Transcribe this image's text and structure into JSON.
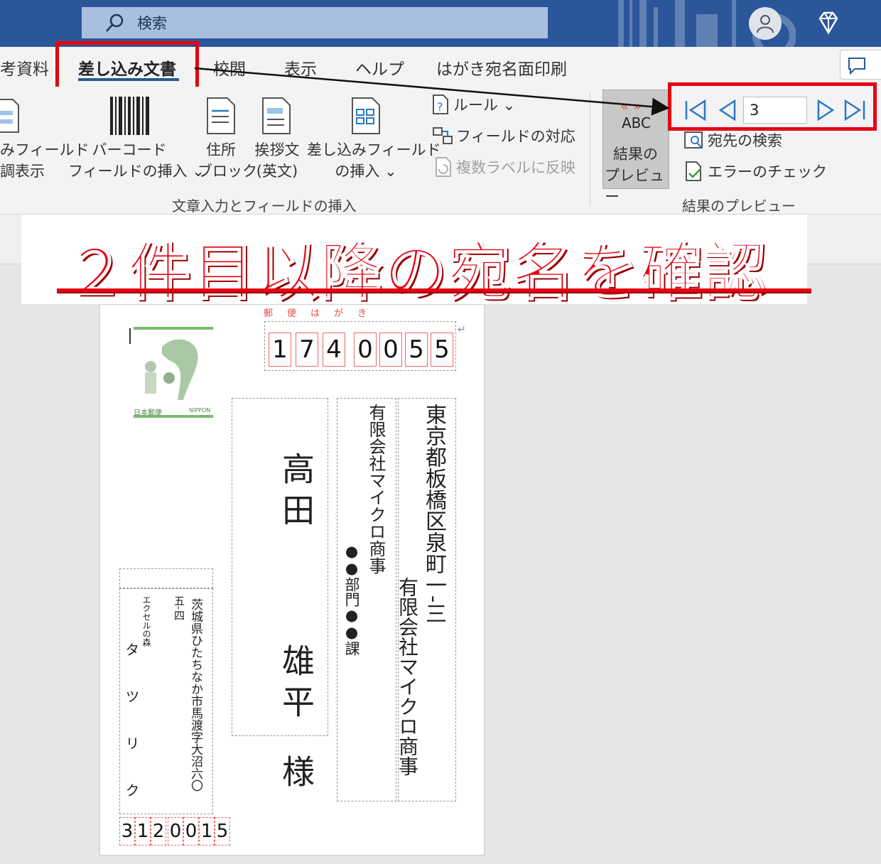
{
  "search": {
    "placeholder_text": "検索"
  },
  "tabs": [
    {
      "label": "考資料"
    },
    {
      "label": "差し込み文書"
    },
    {
      "label": "校閲"
    },
    {
      "label": "表示"
    },
    {
      "label": "ヘルプ"
    },
    {
      "label": "はがき宛名面印刷"
    }
  ],
  "ribbon": {
    "fields_highlight": {
      "line1": "みフィールド",
      "line2": "調表示"
    },
    "barcode": {
      "line1": "バーコード",
      "line2": "フィールドの挿入 ⌄"
    },
    "address_block": {
      "line1": "住所",
      "line2": "ブロック"
    },
    "greeting": {
      "line1": "挨拶文",
      "line2": "(英文)"
    },
    "insert_merge_field": {
      "line1": "差し込みフィールド",
      "line2": "の挿入 ⌄"
    },
    "rules": "ルール ⌄",
    "match_fields": "フィールドの対応",
    "update_labels": "複数ラベルに反映",
    "group1_label": "文章入力とフィールドの挿入",
    "preview": {
      "abc": "ABC",
      "arrows": "«»",
      "line1": "結果の",
      "line2": "プレビュー"
    },
    "record_value": "3",
    "find_recipient": "宛先の検索",
    "check_errors": "エラーのチェック",
    "group2_label": "結果のプレビュー"
  },
  "callout": {
    "text": "２件目以降の宛名を確認"
  },
  "postcard": {
    "header": "郵便はがき",
    "stamp_left": "日本郵便",
    "stamp_right": "NIPPON",
    "zip": [
      "1",
      "7",
      "4",
      "0",
      "0",
      "5",
      "5"
    ],
    "recipient_address_1": "東京都板橋区泉町一‐三",
    "recipient_company_a": "有限会社マイクロ商事",
    "recipient_company_b": "有限会社マイクロ商事",
    "recipient_dept": "●●部門●●課",
    "recipient_name_family": "高田",
    "recipient_name_given": "雄平",
    "honorific": "様",
    "sender_address_1": "茨城県ひたちなか市馬渡字大沼六〇",
    "sender_address_2": "五‐四",
    "sender_company": "エクセルの森",
    "sender_name": "タツリク",
    "sender_zip": [
      "3",
      "1",
      "2",
      "0",
      "0",
      "1",
      "5"
    ]
  }
}
